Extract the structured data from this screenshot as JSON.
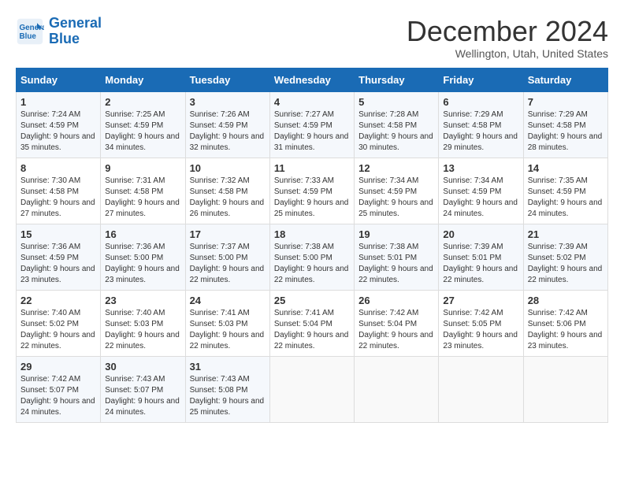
{
  "header": {
    "logo_line1": "General",
    "logo_line2": "Blue",
    "month": "December 2024",
    "location": "Wellington, Utah, United States"
  },
  "weekdays": [
    "Sunday",
    "Monday",
    "Tuesday",
    "Wednesday",
    "Thursday",
    "Friday",
    "Saturday"
  ],
  "weeks": [
    [
      {
        "day": "1",
        "sunrise": "7:24 AM",
        "sunset": "4:59 PM",
        "daylight": "9 hours and 35 minutes."
      },
      {
        "day": "2",
        "sunrise": "7:25 AM",
        "sunset": "4:59 PM",
        "daylight": "9 hours and 34 minutes."
      },
      {
        "day": "3",
        "sunrise": "7:26 AM",
        "sunset": "4:59 PM",
        "daylight": "9 hours and 32 minutes."
      },
      {
        "day": "4",
        "sunrise": "7:27 AM",
        "sunset": "4:59 PM",
        "daylight": "9 hours and 31 minutes."
      },
      {
        "day": "5",
        "sunrise": "7:28 AM",
        "sunset": "4:58 PM",
        "daylight": "9 hours and 30 minutes."
      },
      {
        "day": "6",
        "sunrise": "7:29 AM",
        "sunset": "4:58 PM",
        "daylight": "9 hours and 29 minutes."
      },
      {
        "day": "7",
        "sunrise": "7:29 AM",
        "sunset": "4:58 PM",
        "daylight": "9 hours and 28 minutes."
      }
    ],
    [
      {
        "day": "8",
        "sunrise": "7:30 AM",
        "sunset": "4:58 PM",
        "daylight": "9 hours and 27 minutes."
      },
      {
        "day": "9",
        "sunrise": "7:31 AM",
        "sunset": "4:58 PM",
        "daylight": "9 hours and 27 minutes."
      },
      {
        "day": "10",
        "sunrise": "7:32 AM",
        "sunset": "4:58 PM",
        "daylight": "9 hours and 26 minutes."
      },
      {
        "day": "11",
        "sunrise": "7:33 AM",
        "sunset": "4:59 PM",
        "daylight": "9 hours and 25 minutes."
      },
      {
        "day": "12",
        "sunrise": "7:34 AM",
        "sunset": "4:59 PM",
        "daylight": "9 hours and 25 minutes."
      },
      {
        "day": "13",
        "sunrise": "7:34 AM",
        "sunset": "4:59 PM",
        "daylight": "9 hours and 24 minutes."
      },
      {
        "day": "14",
        "sunrise": "7:35 AM",
        "sunset": "4:59 PM",
        "daylight": "9 hours and 24 minutes."
      }
    ],
    [
      {
        "day": "15",
        "sunrise": "7:36 AM",
        "sunset": "4:59 PM",
        "daylight": "9 hours and 23 minutes."
      },
      {
        "day": "16",
        "sunrise": "7:36 AM",
        "sunset": "5:00 PM",
        "daylight": "9 hours and 23 minutes."
      },
      {
        "day": "17",
        "sunrise": "7:37 AM",
        "sunset": "5:00 PM",
        "daylight": "9 hours and 22 minutes."
      },
      {
        "day": "18",
        "sunrise": "7:38 AM",
        "sunset": "5:00 PM",
        "daylight": "9 hours and 22 minutes."
      },
      {
        "day": "19",
        "sunrise": "7:38 AM",
        "sunset": "5:01 PM",
        "daylight": "9 hours and 22 minutes."
      },
      {
        "day": "20",
        "sunrise": "7:39 AM",
        "sunset": "5:01 PM",
        "daylight": "9 hours and 22 minutes."
      },
      {
        "day": "21",
        "sunrise": "7:39 AM",
        "sunset": "5:02 PM",
        "daylight": "9 hours and 22 minutes."
      }
    ],
    [
      {
        "day": "22",
        "sunrise": "7:40 AM",
        "sunset": "5:02 PM",
        "daylight": "9 hours and 22 minutes."
      },
      {
        "day": "23",
        "sunrise": "7:40 AM",
        "sunset": "5:03 PM",
        "daylight": "9 hours and 22 minutes."
      },
      {
        "day": "24",
        "sunrise": "7:41 AM",
        "sunset": "5:03 PM",
        "daylight": "9 hours and 22 minutes."
      },
      {
        "day": "25",
        "sunrise": "7:41 AM",
        "sunset": "5:04 PM",
        "daylight": "9 hours and 22 minutes."
      },
      {
        "day": "26",
        "sunrise": "7:42 AM",
        "sunset": "5:04 PM",
        "daylight": "9 hours and 22 minutes."
      },
      {
        "day": "27",
        "sunrise": "7:42 AM",
        "sunset": "5:05 PM",
        "daylight": "9 hours and 23 minutes."
      },
      {
        "day": "28",
        "sunrise": "7:42 AM",
        "sunset": "5:06 PM",
        "daylight": "9 hours and 23 minutes."
      }
    ],
    [
      {
        "day": "29",
        "sunrise": "7:42 AM",
        "sunset": "5:07 PM",
        "daylight": "9 hours and 24 minutes."
      },
      {
        "day": "30",
        "sunrise": "7:43 AM",
        "sunset": "5:07 PM",
        "daylight": "9 hours and 24 minutes."
      },
      {
        "day": "31",
        "sunrise": "7:43 AM",
        "sunset": "5:08 PM",
        "daylight": "9 hours and 25 minutes."
      },
      null,
      null,
      null,
      null
    ]
  ]
}
